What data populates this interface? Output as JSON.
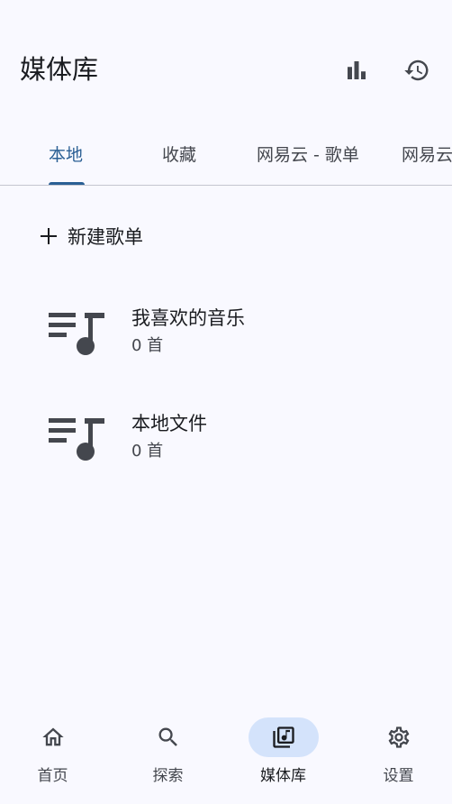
{
  "app_bar": {
    "title": "媒体库",
    "actions": [
      {
        "icon": "bar-chart-icon"
      },
      {
        "icon": "history-icon"
      }
    ]
  },
  "tabs": {
    "active_index": 0,
    "items": [
      {
        "label": "本地"
      },
      {
        "label": "收藏"
      },
      {
        "label": "网易云 - 歌单"
      },
      {
        "label": "网易云"
      }
    ]
  },
  "new_playlist": {
    "icon": "plus-icon",
    "label": "新建歌单"
  },
  "playlists": [
    {
      "name": "我喜欢的音乐",
      "count": "0 首",
      "icon": "playlist-music-icon"
    },
    {
      "name": "本地文件",
      "count": "0 首",
      "icon": "playlist-music-icon"
    }
  ],
  "bottom_nav": {
    "active_index": 2,
    "items": [
      {
        "label": "首页",
        "icon": "home-icon"
      },
      {
        "label": "探索",
        "icon": "search-icon"
      },
      {
        "label": "媒体库",
        "icon": "library-music-icon"
      },
      {
        "label": "设置",
        "icon": "gear-icon"
      }
    ]
  },
  "colors": {
    "background": "#f9f9ff",
    "accent": "#2a5f94",
    "nav_active_pill": "#d4e3fb",
    "icon": "#44474e",
    "divider": "#c4c6d0"
  }
}
